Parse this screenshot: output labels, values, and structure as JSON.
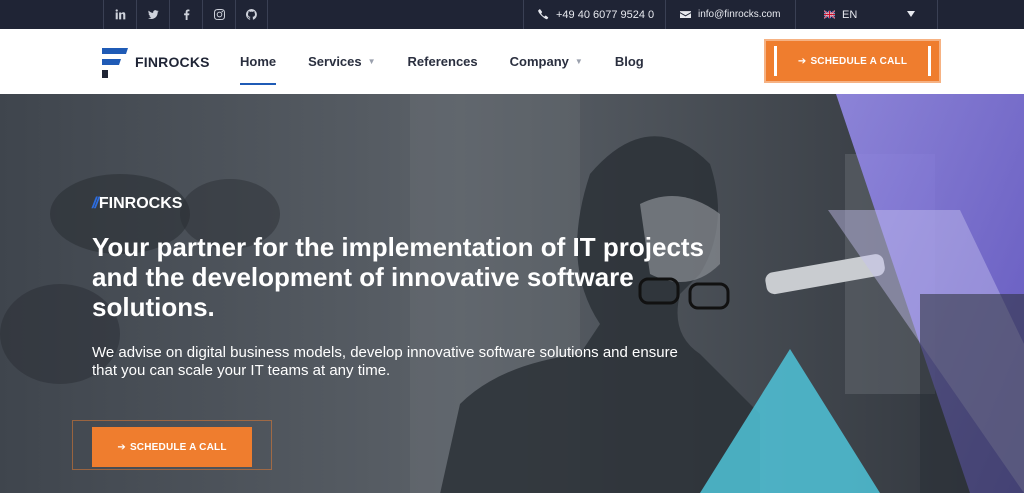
{
  "topbar": {
    "social": [
      {
        "icon": "linkedin-icon"
      },
      {
        "icon": "twitter-icon"
      },
      {
        "icon": "facebook-icon"
      },
      {
        "icon": "instagram-icon"
      },
      {
        "icon": "github-icon"
      }
    ],
    "phone": "+49 40 6077 9524 0",
    "email": "info@finrocks.com",
    "language": "EN"
  },
  "header": {
    "logo_text": "FINROCKS",
    "nav": {
      "home": "Home",
      "services": "Services",
      "references": "References",
      "company": "Company",
      "blog": "Blog"
    },
    "cta": "SCHEDULE A CALL"
  },
  "hero": {
    "brand": "FINROCKS",
    "headline": "Your partner for the implementation of IT projects and the development of innovative software solutions.",
    "subline": "We advise on digital business models, develop innovative software solutions and ensure that you can scale your IT teams at any time.",
    "cta": "SCHEDULE A CALL"
  },
  "colors": {
    "topbar": "#1f2435",
    "accent": "#ef7d2e",
    "brand_blue": "#1f5bb6",
    "purple": "#8a7ee0",
    "cyan": "#4fc3d8"
  }
}
